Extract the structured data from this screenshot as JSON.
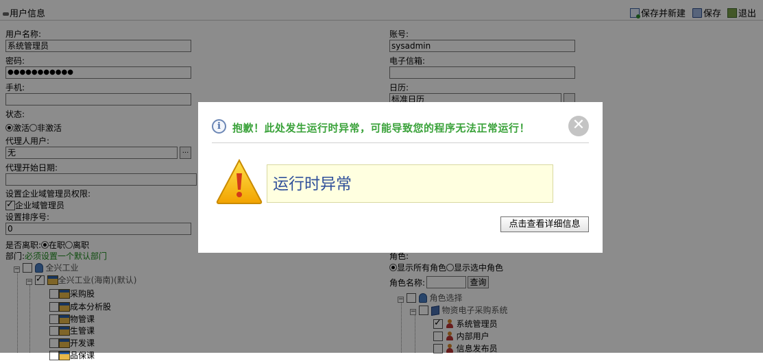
{
  "header": {
    "title": "用户信息",
    "save_new_label": "保存并新建",
    "save_label": "保存",
    "exit_label": "退出"
  },
  "form": {
    "username_label": "用户名称:",
    "username_value": "系统管理员",
    "account_label": "账号:",
    "account_value": "sysadmin",
    "password_label": "密码:",
    "password_value": "●●●●●●●●●●●",
    "email_label": "电子信箱:",
    "email_value": "",
    "phone_label": "手机:",
    "phone_value": "",
    "calendar_label": "日历:",
    "calendar_value": "标准日历",
    "status_label": "状态:",
    "status_active": "激活",
    "status_inactive": "非激活",
    "proxy_user_label": "代理人用户:",
    "proxy_user_value": "无",
    "proxy_start_label": "代理开始日期:",
    "proxy_start_value": "",
    "enterprise_admin_label": "设置企业域管理员权限:",
    "enterprise_admin_checkbox": "企业域管理员",
    "sort_label": "设置排序号:",
    "sort_value": "0",
    "resigned_label": "是否离职:",
    "resigned_on": "在职",
    "resigned_off": "离职",
    "dept_label": "部门:",
    "dept_hint": "必须设置一个默认部门",
    "role_label": "角色:",
    "role_show_all": "显示所有角色",
    "role_show_selected": "显示选中角色",
    "role_name_label": "角色名称:",
    "role_name_value": "",
    "query_button": "查询"
  },
  "dept_tree": {
    "root": "全兴工业",
    "branch": "全兴工业(海南)(默认)",
    "items": [
      "采购股",
      "成本分析股",
      "物管课",
      "生管课",
      "开发课",
      "品保课"
    ]
  },
  "role_tree": {
    "root": "角色选择",
    "branch": "物资电子采购系统",
    "items": [
      {
        "label": "系统管理员",
        "checked": true
      },
      {
        "label": "内部用户",
        "checked": false
      },
      {
        "label": "信息发布员",
        "checked": false
      }
    ]
  },
  "dialog": {
    "message": "抱歉！此处发生运行时异常，可能导致您的程序无法正常运行！",
    "error_title": "运行时异常",
    "detail_button": "点击查看详细信息",
    "close_symbol": "✕",
    "info_symbol": "i"
  },
  "colors": {
    "message_green": "#3aa23a",
    "error_text_blue": "#2f4f9a",
    "error_box_bg": "#ffffe0",
    "overlay": "rgba(0,0,0,0.45)"
  }
}
